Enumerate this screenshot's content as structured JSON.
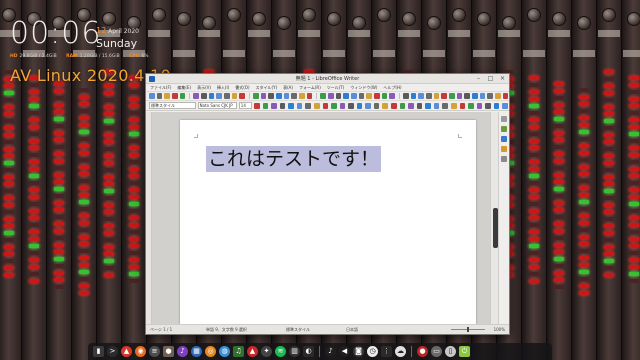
{
  "conky": {
    "time": "00:06",
    "day_number": "12",
    "month_year": "April 2020",
    "weekday": "Sunday",
    "stats": [
      {
        "key": "HD",
        "value": "29.6GiB / 2.4GiB"
      },
      {
        "key": "RAM",
        "value": "1.20GiB / 15.6GiB"
      },
      {
        "key": "CPU",
        "value": "6%"
      }
    ],
    "brand": "AV Linux 2020.4.10"
  },
  "window": {
    "title": "無題 1 - LibreOffice Writer",
    "controls": [
      "–",
      "□",
      "×"
    ],
    "menu": [
      "ファイル(F)",
      "編集(E)",
      "表示(V)",
      "挿入(I)",
      "書式(O)",
      "スタイル(Y)",
      "表(A)",
      "フォーム(R)",
      "ツール(T)",
      "ウィンドウ(W)",
      "ヘルプ(H)"
    ],
    "paragraph_style": "標準スタイル",
    "font_name": "Noto Sans CJK JP",
    "font_size": "14",
    "document_text": "これはテストです！",
    "status": {
      "page": "ページ 1 / 1",
      "words": "単語 9、文字数 9 選択",
      "page_style": "標準スタイル",
      "language": "日本語",
      "zoom": "100%"
    }
  },
  "dock": {
    "icons": [
      {
        "name": "files-icon",
        "color": "#3a3a3a",
        "glyph": "▮"
      },
      {
        "name": "terminal-icon",
        "color": "#2b2b2b",
        "glyph": ">"
      },
      {
        "name": "pdf-icon",
        "color": "#d33a2c",
        "glyph": "▲"
      },
      {
        "name": "firefox-icon",
        "color": "#e66a1f",
        "glyph": "◉"
      },
      {
        "name": "text-editor-icon",
        "color": "#4d4d4d",
        "glyph": "≡"
      },
      {
        "name": "gimp-icon",
        "color": "#6e6056",
        "glyph": "●"
      },
      {
        "name": "media-icon",
        "color": "#7f3fbf",
        "glyph": "♪"
      },
      {
        "name": "grid-icon",
        "color": "#2d6bb5",
        "glyph": "▦"
      },
      {
        "name": "audacity-icon",
        "color": "#e58a20",
        "glyph": "◎"
      },
      {
        "name": "browser-icon",
        "color": "#3a8fd8",
        "glyph": "◍"
      },
      {
        "name": "music-icon",
        "color": "#2f6f2f",
        "glyph": "♫"
      },
      {
        "name": "ardour-icon",
        "color": "#c9282d",
        "glyph": "▲"
      },
      {
        "name": "app-icon",
        "color": "#444444",
        "glyph": "✦"
      },
      {
        "name": "spotify-icon",
        "color": "#1db954",
        "glyph": "≋"
      },
      {
        "name": "mixer-icon",
        "color": "#333333",
        "glyph": "▥"
      },
      {
        "name": "steam-icon",
        "color": "#2a2a2a",
        "glyph": "◐"
      },
      {
        "name": "audio-icon",
        "color": "#1f1f1f",
        "glyph": "♪"
      },
      {
        "name": "volume-icon",
        "color": "#1f1f1f",
        "glyph": "◀"
      },
      {
        "name": "camera-icon",
        "color": "#3a3a3a",
        "glyph": "◙"
      },
      {
        "name": "clock-icon",
        "color": "#ececec",
        "glyph": "◷"
      },
      {
        "name": "network-icon",
        "color": "#2a2a2a",
        "glyph": "⋮"
      },
      {
        "name": "weather-icon",
        "color": "#e0e0e0",
        "glyph": "☁"
      },
      {
        "name": "recorder-icon",
        "color": "#b82626",
        "glyph": "●"
      },
      {
        "name": "window-preview-icon",
        "color": "#6a6a6a",
        "glyph": "▭"
      },
      {
        "name": "trash-icon",
        "color": "#c8c8c8",
        "glyph": "▯"
      },
      {
        "name": "logout-icon",
        "color": "#8cc63f",
        "glyph": "⏻"
      }
    ]
  }
}
